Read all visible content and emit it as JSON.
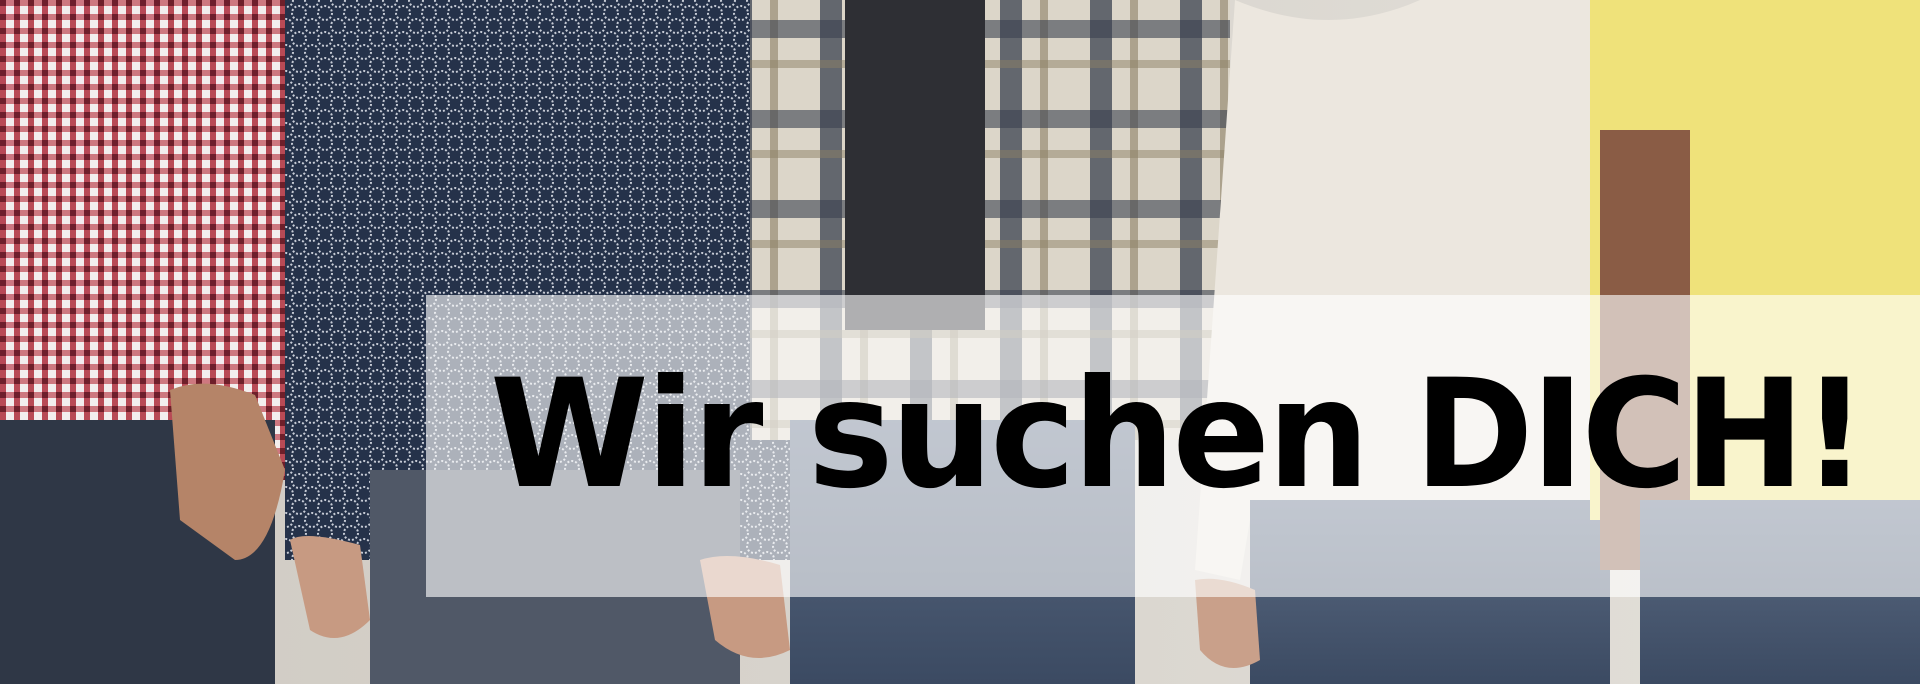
{
  "banner": {
    "headline": "Wir suchen DICH!",
    "background_color": "#ffffff",
    "text_color": "#000000"
  },
  "photo": {
    "subject": "five-people-standing-in-a-row",
    "colors": {
      "red_check_shirt": "#b84a55",
      "navy_patterned_blouse": "#25324a",
      "plaid_flannel_shirt": "#c9c3b6",
      "cream_sweater": "#ece7df",
      "yellow_tshirt": "#efe27a",
      "denim": "#4a5a72"
    }
  }
}
